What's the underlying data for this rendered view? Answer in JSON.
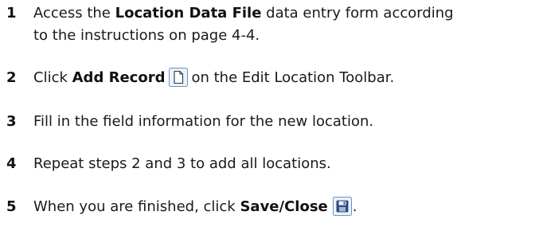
{
  "steps": [
    {
      "number": "1",
      "pre": "Access the ",
      "bold": "Location Data File",
      "post": " data entry form according",
      "line2": "to the instructions on page 4-4."
    },
    {
      "number": "2",
      "pre": "Click ",
      "bold": "Add Record",
      "icon": "new-document-icon",
      "post": "on the Edit Location Toolbar."
    },
    {
      "number": "3",
      "text": "Fill in the field information for the new location."
    },
    {
      "number": "4",
      "text": "Repeat steps 2 and 3 to add all locations."
    },
    {
      "number": "5",
      "pre": "When you are finished, click ",
      "bold": "Save/Close",
      "icon": "save-disk-icon",
      "post": "."
    }
  ],
  "colors": {
    "icon_border": "#6b93c7",
    "icon_fill": "#eaf2fc",
    "text": "#1a1a1a"
  }
}
